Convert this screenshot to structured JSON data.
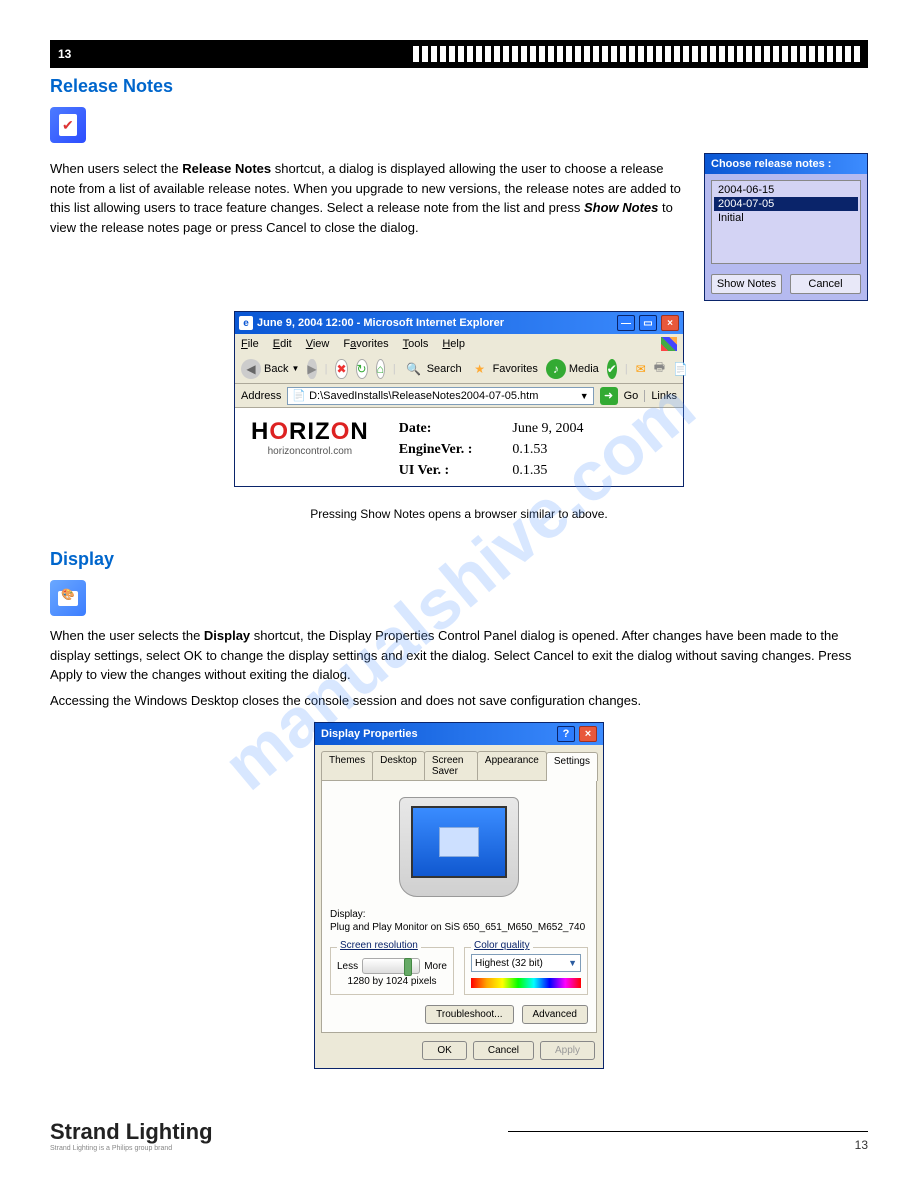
{
  "watermark": "manualshive.com",
  "section1": {
    "title": "Release Notes",
    "para1_pre": "When users select the ",
    "para1_b": "Release Notes",
    "para1_post": " shortcut, a dialog is displayed allowing the user to choose a release note from a list of available release notes. When you upgrade to new versions, the release notes are added to this list allowing users to trace feature changes. Select a release note from the list and press ",
    "para1_b2": "Show Notes",
    "para1_post2": " to view the release notes page or press Cancel to close the dialog."
  },
  "releaseDialog": {
    "title": "Choose release notes :",
    "items": [
      "2004-06-15",
      "2004-07-05",
      "Initial"
    ],
    "selectedIndex": 1,
    "showBtn": "Show Notes",
    "cancelBtn": "Cancel"
  },
  "ie": {
    "title": "June 9, 2004 12:00 - Microsoft Internet Explorer",
    "menus": [
      "File",
      "Edit",
      "View",
      "Favorites",
      "Tools",
      "Help"
    ],
    "back": "Back",
    "search": "Search",
    "favs": "Favorites",
    "media": "Media",
    "addrLabel": "Address",
    "addrValue": "D:\\SavedInstalls\\ReleaseNotes2004-07-05.htm",
    "goLabel": "Go",
    "linksLabel": "Links",
    "brand_top": "HORIZON",
    "brand_sub": "horizoncontrol.com",
    "labels": [
      "Date:",
      "EngineVer. :",
      "UI Ver. :"
    ],
    "values": [
      "June 9, 2004",
      "0.1.53",
      "0.1.35"
    ]
  },
  "centerNote": "Pressing Show Notes opens a browser similar to above.",
  "section2": {
    "title": "Display",
    "para1_pre": "When the user selects the ",
    "para1_b": "Display",
    "para1_post": " shortcut, the Display Properties Control Panel dialog is opened. After changes have been made to the display settings, select OK to change the display settings and exit the dialog. Select Cancel to exit the dialog without saving changes. Press Apply to view the changes without exiting the dialog.",
    "para2": "Accessing the Windows Desktop closes the console session and does not save configuration changes."
  },
  "display": {
    "title": "Display Properties",
    "tabs": [
      "Themes",
      "Desktop",
      "Screen Saver",
      "Appearance",
      "Settings"
    ],
    "activeTab": 4,
    "displayLabel": "Display:",
    "displayDesc": "Plug and Play Monitor on SiS 650_651_M650_M652_740",
    "groupRes": "Screen resolution",
    "less": "Less",
    "more": "More",
    "resText": "1280 by 1024 pixels",
    "groupCQ": "Color quality",
    "cqValue": "Highest (32 bit)",
    "trouble": "Troubleshoot...",
    "adv": "Advanced",
    "ok": "OK",
    "cancel": "Cancel",
    "apply": "Apply"
  },
  "footer": {
    "brand": "Strand Lighting",
    "brandSub": "Strand Lighting is a Philips group brand",
    "pageNum": "13"
  }
}
